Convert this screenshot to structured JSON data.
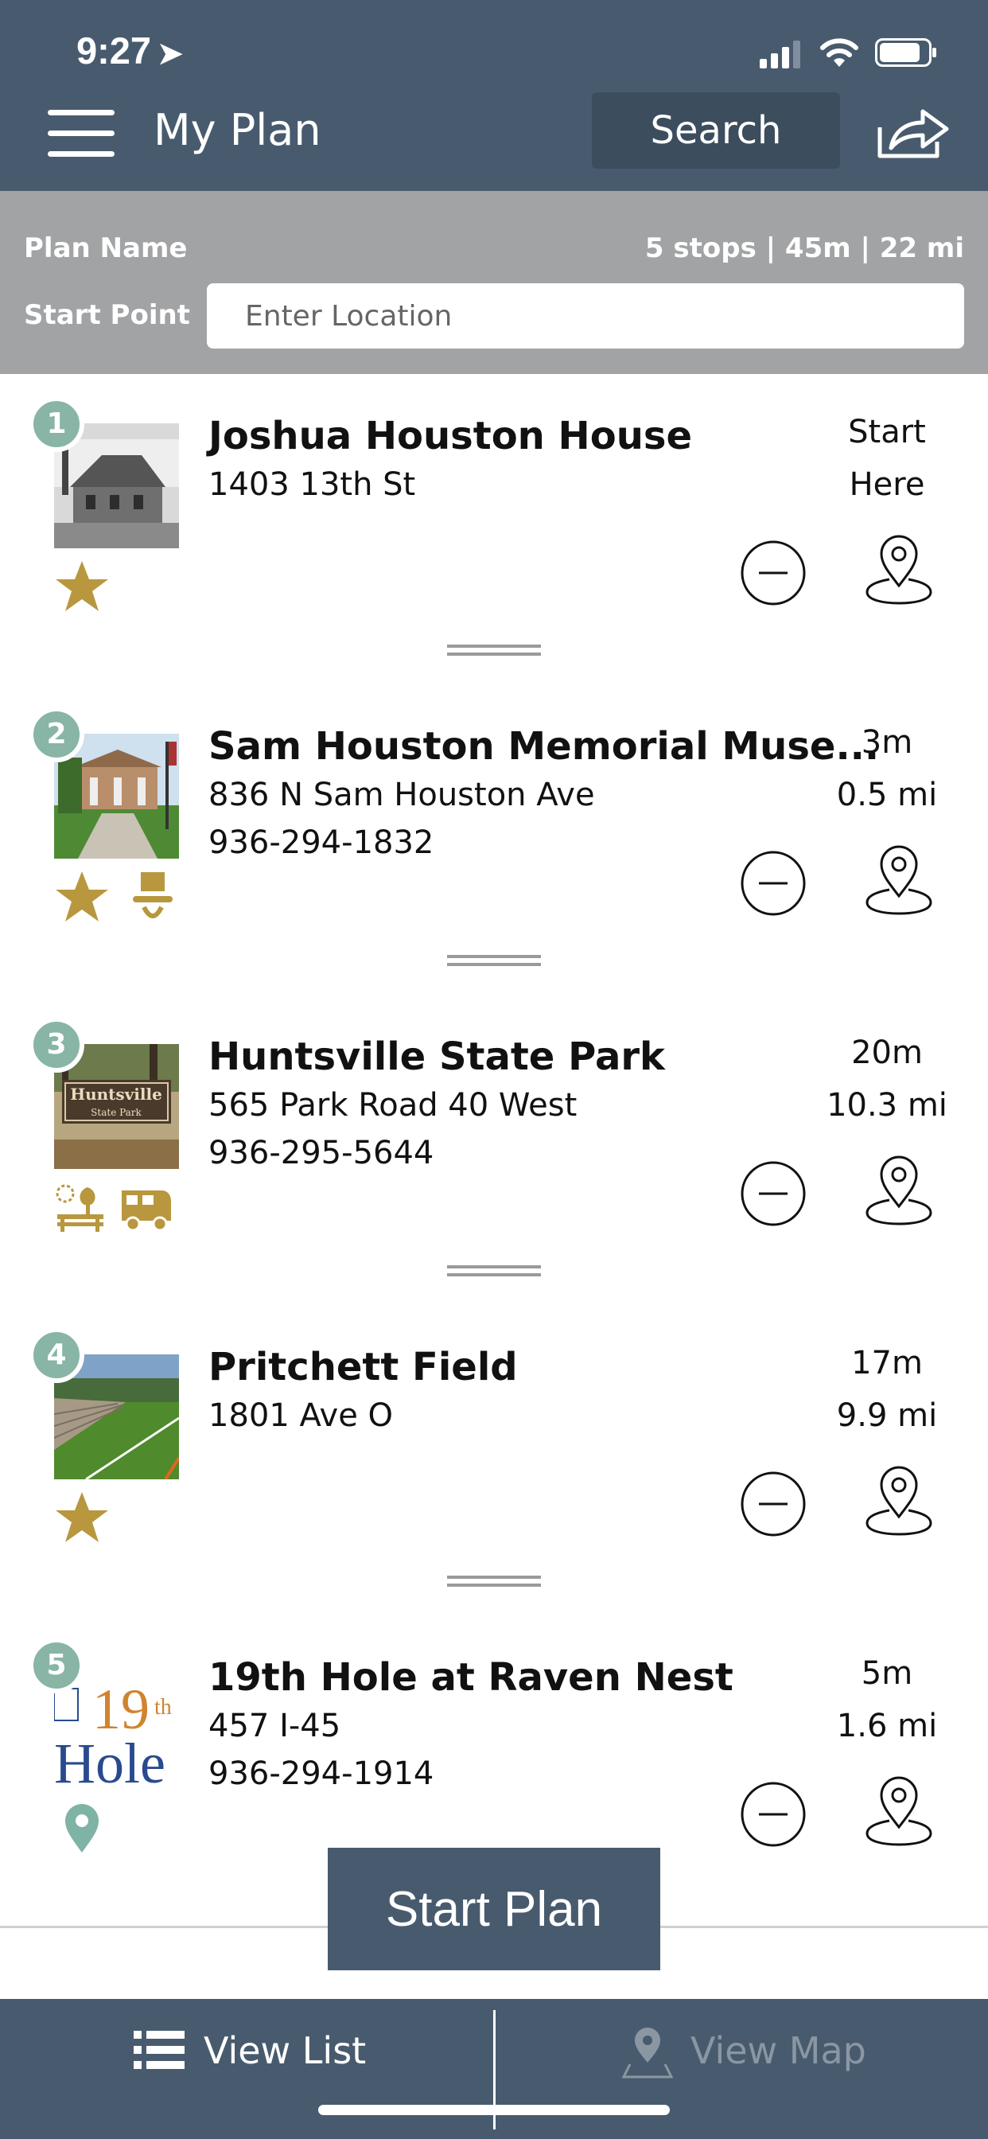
{
  "status_bar": {
    "time": "9:27"
  },
  "header": {
    "title": "My Plan",
    "search_label": "Search"
  },
  "plan": {
    "name_label": "Plan Name",
    "stats": "5 stops | 45m | 22 mi",
    "start_label": "Start Point",
    "start_placeholder": "Enter Location"
  },
  "stops": [
    {
      "number": "1",
      "name": "Joshua Houston House",
      "address": "1403 13th St",
      "phone": "",
      "time": "Start",
      "distance": "Here",
      "badges": [
        "star-icon"
      ]
    },
    {
      "number": "2",
      "name": "Sam Houston Memorial Muse...",
      "address": "836 N Sam Houston Ave",
      "phone": "936-294-1832",
      "time": "3m",
      "distance": "0.5 mi",
      "badges": [
        "star-icon",
        "top-hat-icon"
      ]
    },
    {
      "number": "3",
      "name": "Huntsville State Park",
      "address": "565 Park Road 40 West",
      "phone": "936-295-5644",
      "time": "20m",
      "distance": "10.3 mi",
      "badges": [
        "park-bench-icon",
        "rv-icon"
      ]
    },
    {
      "number": "4",
      "name": "Pritchett Field",
      "address": "1801 Ave O",
      "phone": "",
      "time": "17m",
      "distance": "9.9 mi",
      "badges": [
        "star-icon"
      ]
    },
    {
      "number": "5",
      "name": "19th Hole at Raven Nest",
      "address": "457 I-45",
      "phone": "936-294-1914",
      "time": "5m",
      "distance": "1.6 mi",
      "badges": [
        "location-pin-icon"
      ]
    }
  ],
  "thumbnail_text": {
    "park_sign": "Huntsville",
    "park_sign_sub": "State Park",
    "hole_logo_top": "19",
    "hole_logo_sup": "th",
    "hole_logo_bottom": "Hole"
  },
  "actions": {
    "start_plan": "Start Plan"
  },
  "bottom_tabs": {
    "list": "View List",
    "map": "View Map"
  },
  "colors": {
    "header": "#485b6e",
    "plan_bar": "#a1a3a5",
    "badge_gold": "#b8973e",
    "number_circle": "#88b5a5",
    "pin_teal": "#7fb3a5"
  }
}
